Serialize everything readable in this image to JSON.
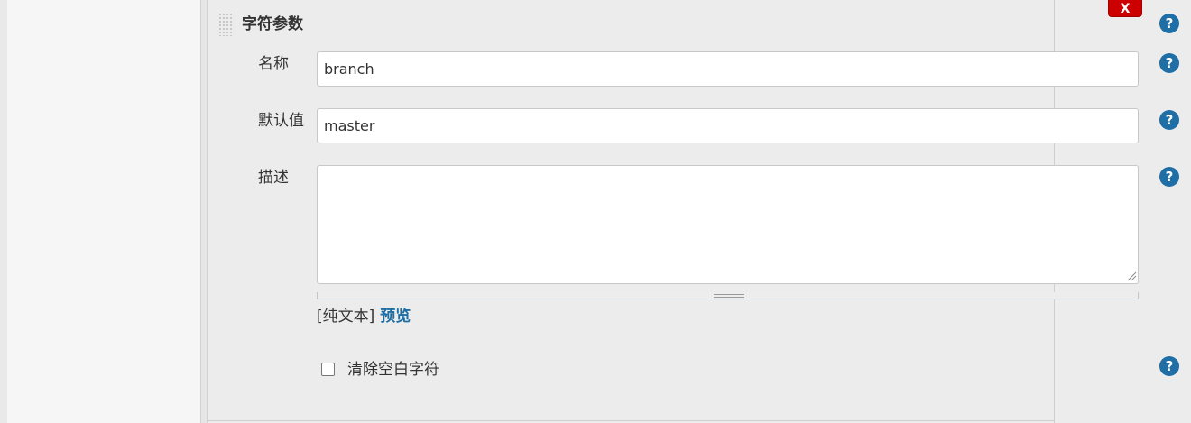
{
  "section": {
    "title": "字符参数",
    "delete_label": "X"
  },
  "fields": {
    "name": {
      "label": "名称",
      "value": "branch"
    },
    "default_value": {
      "label": "默认值",
      "value": "master"
    },
    "description": {
      "label": "描述",
      "value": ""
    }
  },
  "markup": {
    "format_label": "[纯文本]",
    "preview_label": "预览"
  },
  "trim": {
    "label": "清除空白字符",
    "checked": false
  },
  "help": {
    "glyph": "?"
  },
  "colors": {
    "accent": "#1f6ea5",
    "delete_button": "#cc0000",
    "panel_background": "#ececec"
  }
}
